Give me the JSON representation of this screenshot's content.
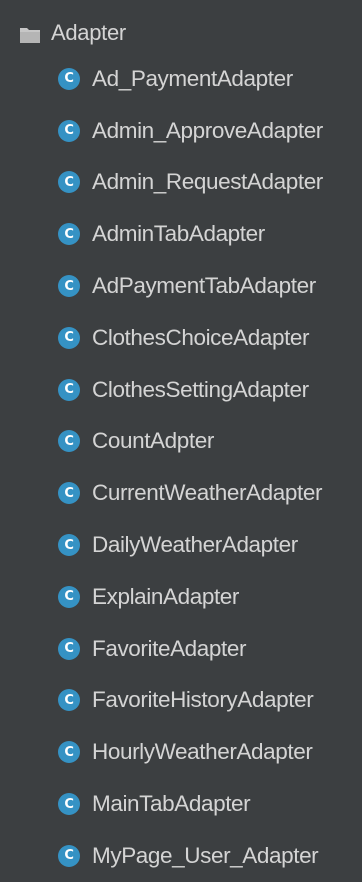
{
  "tree": {
    "folder": {
      "label": "Adapter",
      "icon": "folder-icon"
    },
    "class_icon_glyph": "C",
    "items": [
      {
        "label": "Ad_PaymentAdapter",
        "icon": "class-icon"
      },
      {
        "label": "Admin_ApproveAdapter",
        "icon": "class-icon"
      },
      {
        "label": "Admin_RequestAdapter",
        "icon": "class-icon"
      },
      {
        "label": "AdminTabAdapter",
        "icon": "class-icon"
      },
      {
        "label": "AdPaymentTabAdapter",
        "icon": "class-icon"
      },
      {
        "label": "ClothesChoiceAdapter",
        "icon": "class-icon"
      },
      {
        "label": "ClothesSettingAdapter",
        "icon": "class-icon"
      },
      {
        "label": "CountAdpter",
        "icon": "class-icon"
      },
      {
        "label": "CurrentWeatherAdapter",
        "icon": "class-icon"
      },
      {
        "label": "DailyWeatherAdapter",
        "icon": "class-icon"
      },
      {
        "label": "ExplainAdapter",
        "icon": "class-icon"
      },
      {
        "label": "FavoriteAdapter",
        "icon": "class-icon"
      },
      {
        "label": "FavoriteHistoryAdapter",
        "icon": "class-icon"
      },
      {
        "label": "HourlyWeatherAdapter",
        "icon": "class-icon"
      },
      {
        "label": "MainTabAdapter",
        "icon": "class-icon"
      },
      {
        "label": "MyPage_User_Adapter",
        "icon": "class-icon"
      }
    ],
    "colors": {
      "background": "#3c3f41",
      "text": "#d4d4d4",
      "class_icon": "#3592c4",
      "folder_icon": "#c7c7c7"
    }
  }
}
